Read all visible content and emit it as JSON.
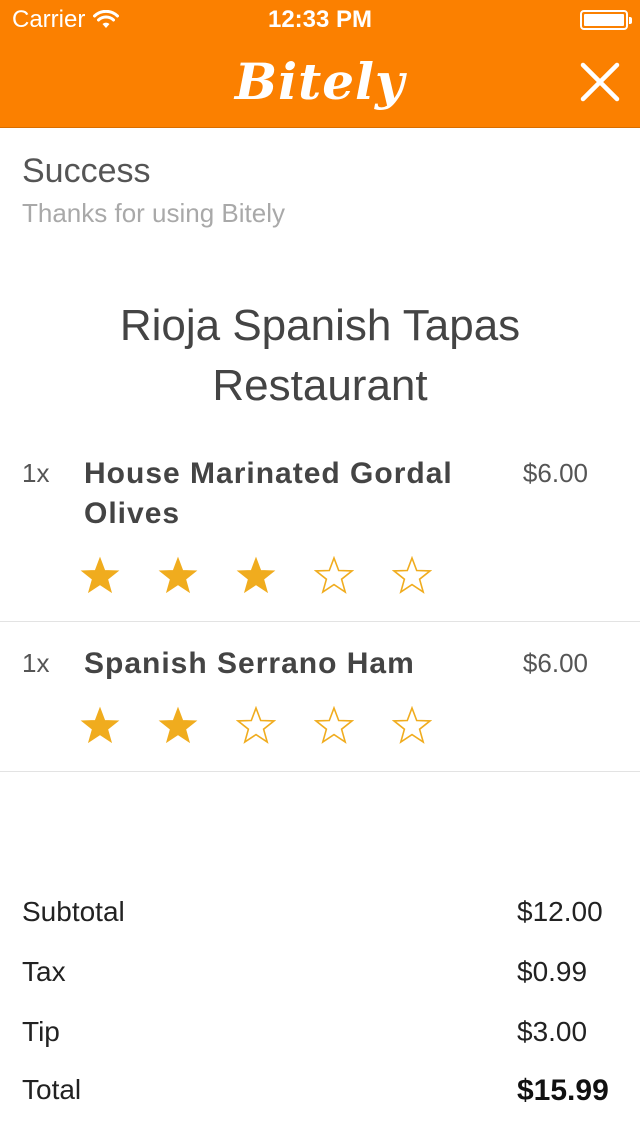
{
  "status_bar": {
    "carrier": "Carrier",
    "time": "12:33 PM"
  },
  "nav": {
    "logo": "Bitely"
  },
  "success": {
    "title": "Success",
    "subtitle": "Thanks for using Bitely"
  },
  "restaurant": {
    "name": "Rioja Spanish Tapas Restaurant"
  },
  "items": [
    {
      "qty": "1x",
      "name": "House Marinated Gordal Olives",
      "price": "$6.00",
      "rating": 3,
      "max_rating": 5
    },
    {
      "qty": "1x",
      "name": "Spanish Serrano Ham",
      "price": "$6.00",
      "rating": 2,
      "max_rating": 5
    }
  ],
  "summary": {
    "subtotal_label": "Subtotal",
    "subtotal": "$12.00",
    "tax_label": "Tax",
    "tax": "$0.99",
    "tip_label": "Tip",
    "tip": "$3.00",
    "total_label": "Total",
    "total": "$15.99"
  },
  "colors": {
    "brand": "#fb8000",
    "star": "#f0ac1e"
  },
  "icons": {
    "close": "close-icon",
    "wifi": "wifi-icon",
    "battery": "battery-icon",
    "star": "star-icon"
  }
}
